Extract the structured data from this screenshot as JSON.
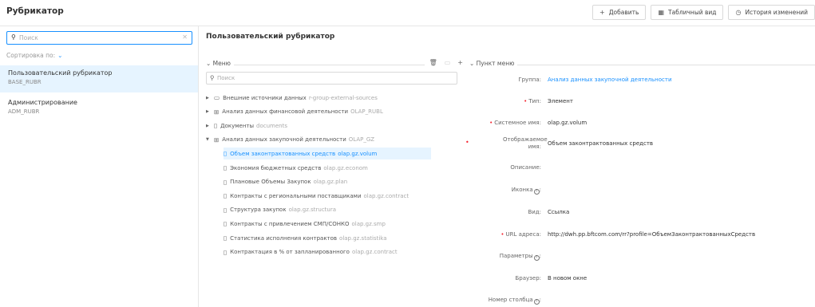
{
  "header": {
    "title": "Рубрикатор",
    "actions": [
      {
        "icon": "plus-icon",
        "label": "Добавить"
      },
      {
        "icon": "table-icon",
        "label": "Табличный вид"
      },
      {
        "icon": "clock-icon",
        "label": "История изменений"
      }
    ]
  },
  "sidebar": {
    "search_placeholder": "Поиск",
    "sort_label": "Сортировка по:",
    "items": [
      {
        "name": "Пользовательский рубрикатор",
        "code": "BASE_RUBR",
        "selected": true
      },
      {
        "name": "Администрирование",
        "code": "ADM_RUBR",
        "selected": false
      }
    ]
  },
  "main": {
    "title": "Пользовательский рубрикатор",
    "menu": {
      "label": "Меню",
      "search_placeholder": "Поиск",
      "tree": [
        {
          "name": "Внешние источники данных",
          "code": "r-group-external-sources",
          "icon": "folder-icon",
          "expand": "collapsed",
          "level": 0
        },
        {
          "name": "Анализ данных финансовой деятельности",
          "code": "OLAP_RUBL",
          "icon": "group-icon",
          "expand": "collapsed",
          "level": 0
        },
        {
          "name": "Документы",
          "code": "documents",
          "icon": "document-icon",
          "expand": "collapsed",
          "level": 0
        },
        {
          "name": "Анализ данных закупочной деятельности",
          "code": "OLAP_GZ",
          "icon": "group-icon",
          "expand": "expanded",
          "level": 0
        },
        {
          "name": "Объем законтрактованных средств",
          "code": "olap.gz.volum",
          "icon": "document-icon",
          "level": 1,
          "selected": true
        },
        {
          "name": "Экономия бюджетных средств",
          "code": "olap.gz.econom",
          "icon": "document-icon",
          "level": 1
        },
        {
          "name": "Плановые Объемы Закупок",
          "code": "olap.gz.plan",
          "icon": "document-icon",
          "level": 1
        },
        {
          "name": "Контракты с региональными поставщиками",
          "code": "olap.gz.contract",
          "icon": "document-icon",
          "level": 1
        },
        {
          "name": "Структура закупок",
          "code": "olap.gz.structura",
          "icon": "document-icon",
          "level": 1
        },
        {
          "name": "Контракты с привлечением СМП/СОНКО",
          "code": "olap.gz.smp",
          "icon": "document-icon",
          "level": 1
        },
        {
          "name": "Статистика исполнения контрактов",
          "code": "olap.gz.statistika",
          "icon": "document-icon",
          "level": 1
        },
        {
          "name": "Контрактация в % от запланированного",
          "code": "olap.gz.contract",
          "icon": "document-icon",
          "level": 1
        }
      ]
    },
    "item": {
      "label": "Пункт меню",
      "fields": [
        {
          "label": "Группа:",
          "value": "Анализ данных закупочной деятельности",
          "link": true,
          "required": false
        },
        {
          "label": "Тип:",
          "value": "Элемент",
          "required": true
        },
        {
          "label": "Системное имя:",
          "value": "olap.gz.volum",
          "required": true
        },
        {
          "label": "Отображаемое имя:",
          "value": "Объем законтрактованных средств",
          "required": true
        },
        {
          "label": "Описание:",
          "value": "",
          "required": false
        },
        {
          "label": "Иконка",
          "value": "",
          "required": false,
          "help": true
        },
        {
          "label": "Вид:",
          "value": "Ссылка",
          "required": false
        },
        {
          "label": "URL адреса:",
          "value": "http://dwh.pp.bftcom.com/rr?profile=ОбъемЗаконтрактованныхСредств",
          "required": true
        },
        {
          "label": "Параметры",
          "value": "",
          "required": false,
          "help": true
        },
        {
          "label": "Браузер:",
          "value": "В новом окне",
          "required": false
        },
        {
          "label": "Номер столбца",
          "value": "",
          "required": false,
          "help": true
        }
      ]
    }
  }
}
